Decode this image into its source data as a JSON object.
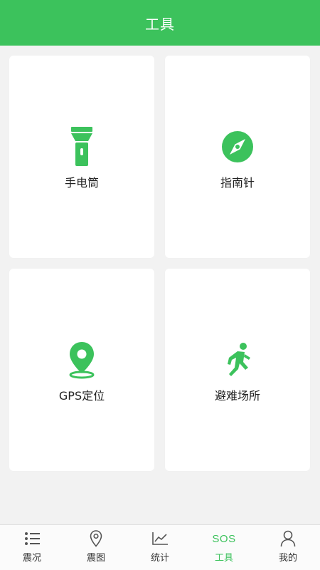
{
  "header": {
    "title": "工具"
  },
  "tools": {
    "flashlight": {
      "label": "手电筒",
      "icon": "flashlight-icon"
    },
    "compass": {
      "label": "指南针",
      "icon": "compass-icon"
    },
    "gps": {
      "label": "GPS定位",
      "icon": "location-pin-icon"
    },
    "shelter": {
      "label": "避难场所",
      "icon": "running-person-icon"
    }
  },
  "tabbar": {
    "items": [
      {
        "label": "震况",
        "icon": "list-icon",
        "active": false
      },
      {
        "label": "震图",
        "icon": "map-pin-icon",
        "active": false
      },
      {
        "label": "统计",
        "icon": "line-chart-icon",
        "active": false
      },
      {
        "label": "工具",
        "icon_text": "SOS",
        "active": true
      },
      {
        "label": "我的",
        "icon": "user-icon",
        "active": false
      }
    ]
  },
  "colors": {
    "accent": "#3cc25c",
    "background": "#f2f2f2",
    "card": "#ffffff",
    "text": "#222222"
  }
}
